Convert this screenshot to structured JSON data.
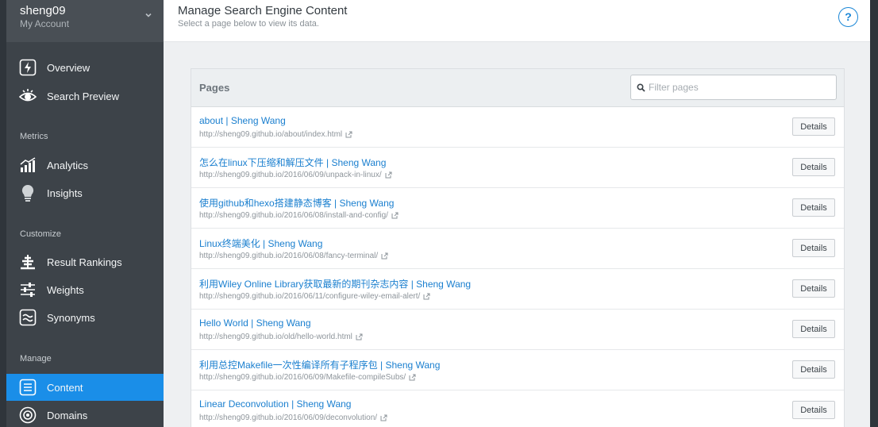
{
  "account": {
    "name": "sheng09",
    "subtitle": "My Account"
  },
  "sidebar": {
    "top_items": [
      {
        "label": "Overview",
        "icon": "bolt-icon"
      },
      {
        "label": "Search Preview",
        "icon": "eye-icon"
      }
    ],
    "sections": [
      {
        "title": "Metrics",
        "items": [
          {
            "label": "Analytics",
            "icon": "bar-chart-icon"
          },
          {
            "label": "Insights",
            "icon": "lightbulb-icon"
          }
        ]
      },
      {
        "title": "Customize",
        "items": [
          {
            "label": "Result Rankings",
            "icon": "rankings-icon"
          },
          {
            "label": "Weights",
            "icon": "sliders-icon"
          },
          {
            "label": "Synonyms",
            "icon": "synonyms-icon"
          }
        ]
      },
      {
        "title": "Manage",
        "items": [
          {
            "label": "Content",
            "icon": "content-icon",
            "active": true
          },
          {
            "label": "Domains",
            "icon": "target-icon"
          }
        ]
      }
    ]
  },
  "header": {
    "title": "Manage Search Engine Content",
    "subtitle": "Select a page below to view its data.",
    "help": "?"
  },
  "panel": {
    "title": "Pages",
    "filter_placeholder": "Filter pages",
    "details_label": "Details",
    "rows": [
      {
        "title": "about | Sheng Wang",
        "url": "http://sheng09.github.io/about/index.html"
      },
      {
        "title": "怎么在linux下压缩和解压文件 | Sheng Wang",
        "url": "http://sheng09.github.io/2016/06/09/unpack-in-linux/"
      },
      {
        "title": "使用github和hexo搭建静态博客 | Sheng Wang",
        "url": "http://sheng09.github.io/2016/06/08/install-and-config/"
      },
      {
        "title": "Linux终端美化 | Sheng Wang",
        "url": "http://sheng09.github.io/2016/06/08/fancy-terminal/"
      },
      {
        "title": "利用Wiley Online Library获取最新的期刊杂志内容 | Sheng Wang",
        "url": "http://sheng09.github.io/2016/06/11/configure-wiley-email-alert/"
      },
      {
        "title": "Hello World | Sheng Wang",
        "url": "http://sheng09.github.io/old/hello-world.html"
      },
      {
        "title": "利用总控Makefile一次性编译所有子程序包 | Sheng Wang",
        "url": "http://sheng09.github.io/2016/06/09/Makefile-compileSubs/"
      },
      {
        "title": "Linear Deconvolution | Sheng Wang",
        "url": "http://sheng09.github.io/2016/06/09/deconvolution/"
      }
    ]
  },
  "colors": {
    "sidebar": "#3d4349",
    "accent": "#1a8ee8",
    "link": "#1a7fcf"
  }
}
